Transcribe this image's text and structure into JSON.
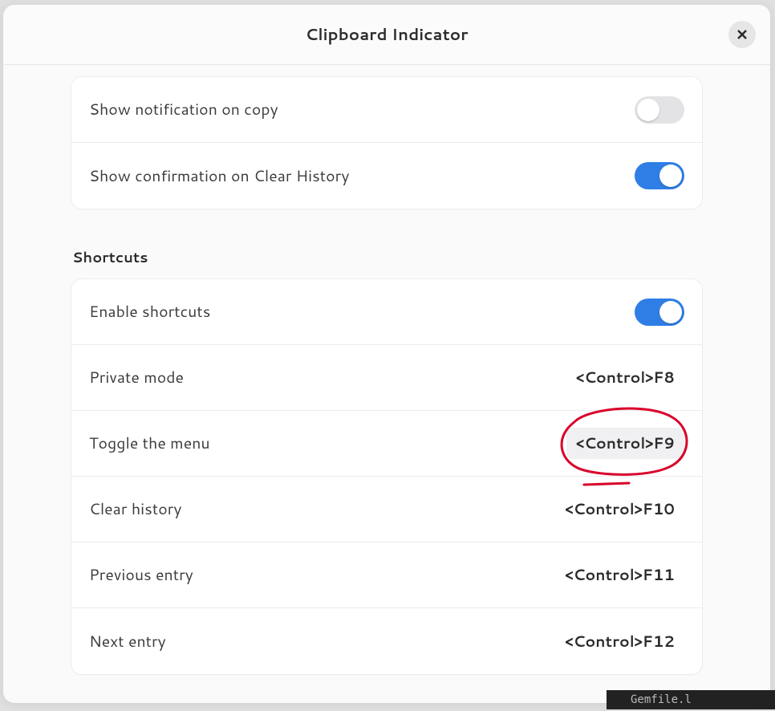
{
  "header": {
    "title": "Clipboard Indicator",
    "close_icon": "close"
  },
  "settings_group_1": {
    "rows": [
      {
        "label": "Show notification on copy",
        "enabled": false
      },
      {
        "label": "Show confirmation on Clear History",
        "enabled": true
      }
    ]
  },
  "shortcuts_section": {
    "heading": "Shortcuts",
    "rows": [
      {
        "label": "Enable shortcuts",
        "type": "switch",
        "enabled": true
      },
      {
        "label": "Private mode",
        "type": "shortcut",
        "value": "<Control>F8",
        "highlighted": false
      },
      {
        "label": "Toggle the menu",
        "type": "shortcut",
        "value": "<Control>F9",
        "highlighted": true
      },
      {
        "label": "Clear history",
        "type": "shortcut",
        "value": "<Control>F10",
        "highlighted": false
      },
      {
        "label": "Previous entry",
        "type": "shortcut",
        "value": "<Control>F11",
        "highlighted": false
      },
      {
        "label": "Next entry",
        "type": "shortcut",
        "value": "<Control>F12",
        "highlighted": false
      }
    ]
  },
  "external": {
    "gemfile": "Gemfile.l"
  }
}
